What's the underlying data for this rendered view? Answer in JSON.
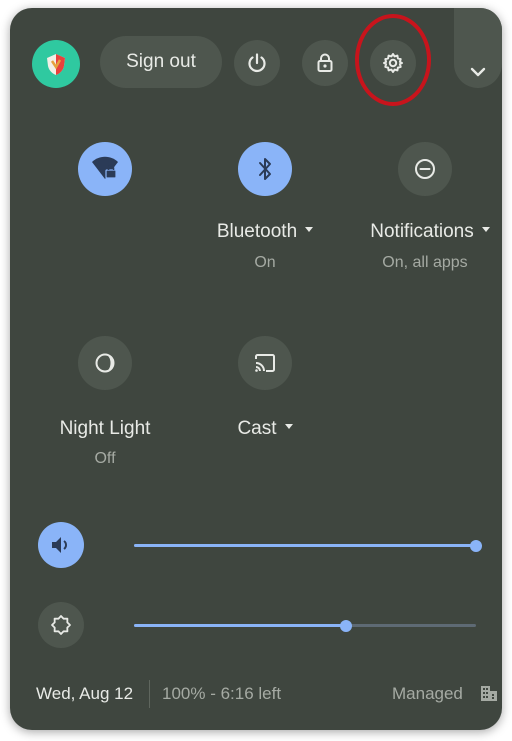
{
  "header": {
    "sign_out_label": "Sign out"
  },
  "tiles": [
    {
      "name": "wifi",
      "label": "",
      "status": "",
      "state": "on",
      "icon": "wifi-lock-icon"
    },
    {
      "name": "bluetooth",
      "label": "Bluetooth",
      "status": "On",
      "state": "on",
      "icon": "bluetooth-icon"
    },
    {
      "name": "notifications",
      "label": "Notifications",
      "status": "On, all apps",
      "state": "off",
      "icon": "do-not-disturb-icon"
    },
    {
      "name": "night-light",
      "label": "Night Light",
      "status": "Off",
      "state": "off",
      "icon": "night-light-icon"
    },
    {
      "name": "cast",
      "label": "Cast",
      "status": "",
      "state": "off",
      "icon": "cast-icon"
    }
  ],
  "sliders": {
    "volume": {
      "value": 1.0,
      "icon": "volume-icon"
    },
    "brightness": {
      "value": 0.62,
      "icon": "brightness-icon"
    }
  },
  "footer": {
    "date": "Wed, Aug 12",
    "battery": "100% - 6:16 left",
    "managed": "Managed"
  },
  "colors": {
    "panel": "#3f463f",
    "accent": "#8ab4f8",
    "highlight": "#c8141c"
  }
}
